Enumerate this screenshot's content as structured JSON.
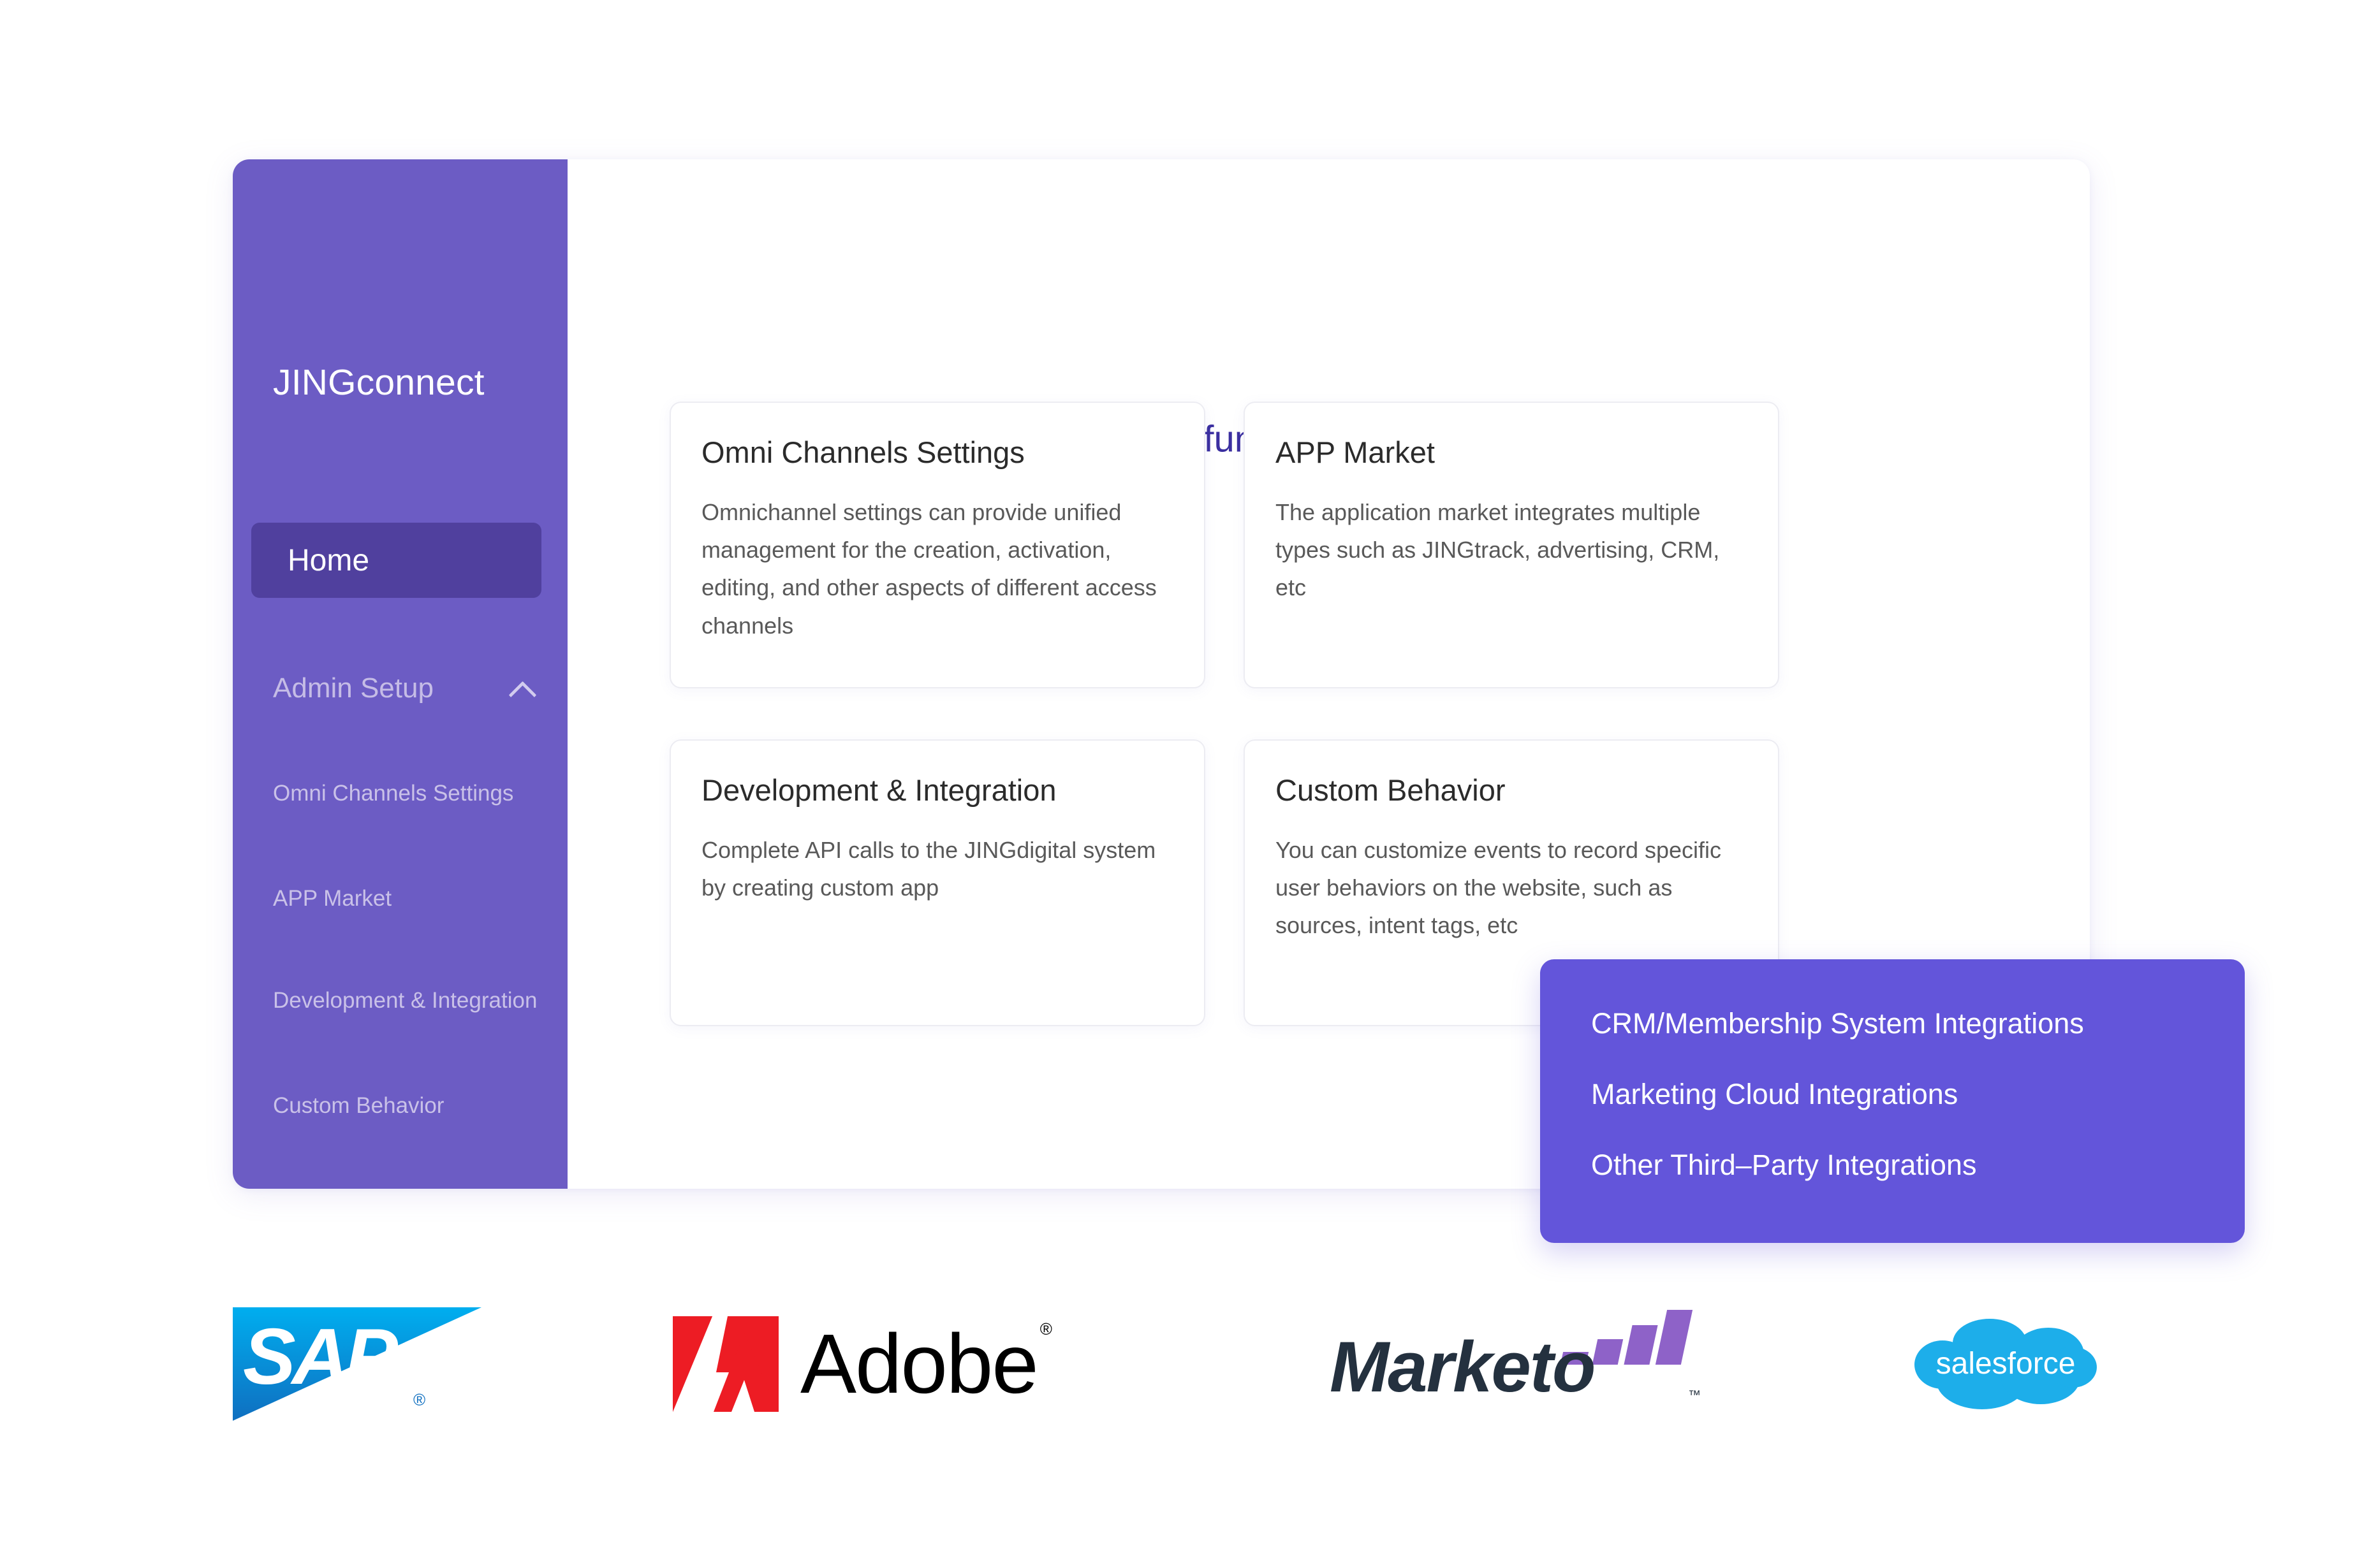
{
  "sidebar": {
    "brand": "JINGconnect",
    "home_label": "Home",
    "group_label": "Admin Setup",
    "group_icon": "chevron-up-icon",
    "sub_items": [
      {
        "label": "Omni Channels Settings"
      },
      {
        "label": "APP Market"
      },
      {
        "label": "Development & Integration"
      },
      {
        "label": "Custom Behavior"
      }
    ]
  },
  "main": {
    "title": "Try these functions of JINGconnect",
    "cards": [
      {
        "title": "Omni Channels Settings",
        "desc": "Omnichannel settings can provide unified management for the creation, activation, editing, and other aspects of different access channels"
      },
      {
        "title": "APP Market",
        "desc": "The application market integrates multiple types such as JINGtrack, advertising, CRM, etc"
      },
      {
        "title": "Development & Integration",
        "desc": "Complete API calls to the JINGdigital system by creating custom app"
      },
      {
        "title": "Custom Behavior",
        "desc": "You can customize events to record specific user behaviors on the website, such as sources, intent tags, etc"
      }
    ]
  },
  "integrations_panel": {
    "items": [
      {
        "label": "CRM/Membership System Integrations"
      },
      {
        "label": "Marketing Cloud Integrations"
      },
      {
        "label": "Other Third–Party Integrations"
      }
    ]
  },
  "logos": [
    {
      "name": "sap-logo",
      "text": "SAP",
      "registered": "®"
    },
    {
      "name": "adobe-logo",
      "text": "Adobe",
      "registered": "®"
    },
    {
      "name": "marketo-logo",
      "text": "Marketo",
      "trademark": "™"
    },
    {
      "name": "salesforce-logo",
      "text": "salesforce"
    }
  ],
  "colors": {
    "sidebar_purple": "#6c5cc4",
    "sidebar_active": "#50409e",
    "panel_purple": "#6355da",
    "title_indigo": "#3b2fa0",
    "card_title": "#2b2b2b",
    "card_text": "#595959",
    "sap_blue": "#0f6fc0",
    "adobe_red": "#ed1c24",
    "marketo_dark": "#24313f",
    "marketo_purple": "#8e62c8",
    "salesforce_blue": "#1daeea"
  }
}
